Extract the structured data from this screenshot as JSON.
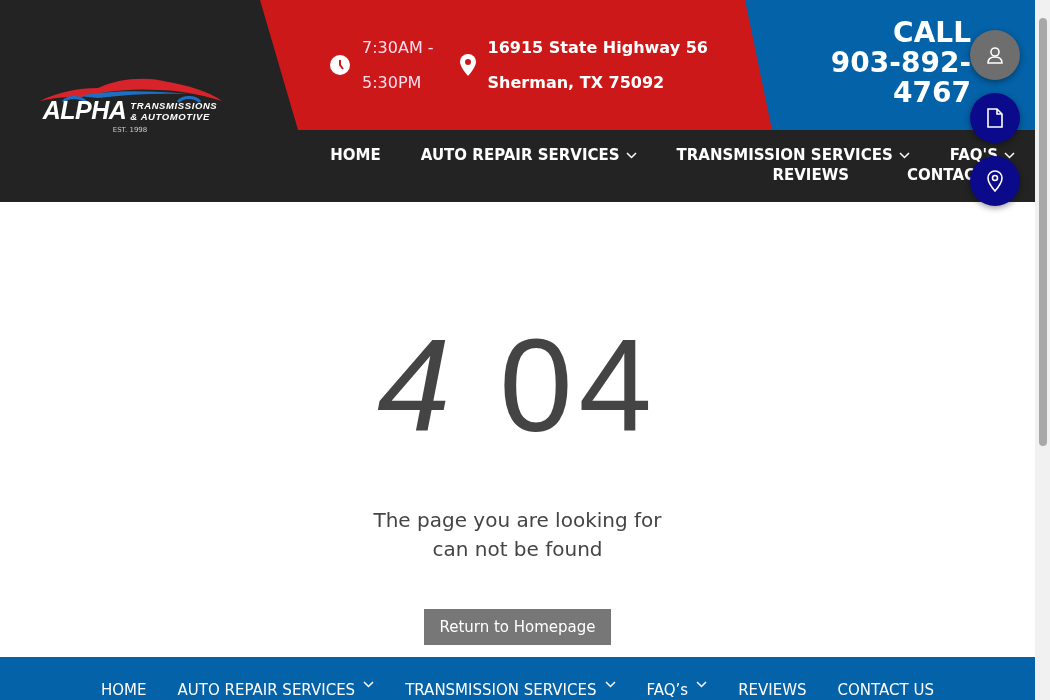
{
  "logo": {
    "name": "ALPHA",
    "line_1": "TRANSMISSIONS",
    "line_2": "& AUTOMOTIVE",
    "established": "EST. 1998"
  },
  "hours": {
    "line_1": "7:30AM -",
    "line_2": "5:30PM"
  },
  "address": {
    "line_1": "16915 State Highway 56",
    "line_2": "Sherman, TX 75092"
  },
  "call": {
    "label": "CALL",
    "phone_1": "903-892-",
    "phone_2": "4767"
  },
  "nav": [
    {
      "label": "HOME",
      "dropdown": false
    },
    {
      "label": "AUTO REPAIR SERVICES",
      "dropdown": true
    },
    {
      "label": "TRANSMISSION SERVICES",
      "dropdown": true
    },
    {
      "label": "FAQ'S",
      "dropdown": true
    }
  ],
  "nav_row_2": [
    {
      "label": "REVIEWS"
    },
    {
      "label": "CONTAC"
    }
  ],
  "floating_buttons": [
    {
      "kind": "person",
      "color": "#6e6e6e"
    },
    {
      "kind": "document",
      "color": "#0a0a8a"
    },
    {
      "kind": "pin",
      "color": "#0a0a8a"
    }
  ],
  "error": {
    "code": "*4* 04",
    "message_1": "The page you are looking for",
    "message_2": "can not be found",
    "button": "Return to Homepage"
  },
  "footer_nav": [
    {
      "label": "HOME",
      "dropdown": false
    },
    {
      "label": "AUTO REPAIR SERVICES",
      "dropdown": true
    },
    {
      "label": "TRANSMISSION SERVICES",
      "dropdown": true
    },
    {
      "label": "FAQ’s",
      "dropdown": true
    },
    {
      "label": "REVIEWS",
      "dropdown": false
    },
    {
      "label": "CONTACT US",
      "dropdown": false
    }
  ]
}
